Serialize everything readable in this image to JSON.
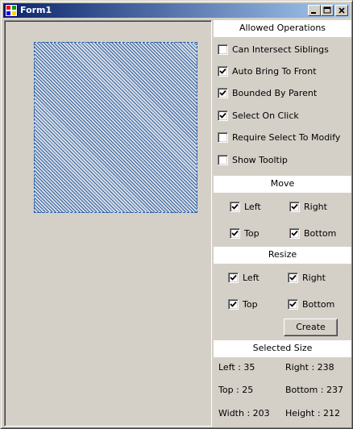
{
  "window": {
    "title": "Form1"
  },
  "caption_buttons": {
    "minimize": "minimize-icon",
    "maximize": "maximize-icon",
    "close": "close-icon"
  },
  "canvas": {
    "shape_fill": "#2e5f9e",
    "shape_border": "#2b5ea7"
  },
  "allowed_operations": {
    "header": "Allowed Operations",
    "options": [
      {
        "label": "Can Intersect Siblings",
        "checked": false
      },
      {
        "label": "Auto Bring To Front",
        "checked": true
      },
      {
        "label": "Bounded By Parent",
        "checked": true
      },
      {
        "label": "Select On Click",
        "checked": true
      },
      {
        "label": "Require Select To Modify",
        "checked": false
      },
      {
        "label": "Show Tooltip",
        "checked": false
      }
    ]
  },
  "move": {
    "header": "Move",
    "left": {
      "label": "Left",
      "checked": true
    },
    "right": {
      "label": "Right",
      "checked": true
    },
    "top": {
      "label": "Top",
      "checked": true
    },
    "bottom": {
      "label": "Bottom",
      "checked": true
    }
  },
  "resize": {
    "header": "Resize",
    "left": {
      "label": "Left",
      "checked": true
    },
    "right": {
      "label": "Right",
      "checked": true
    },
    "top": {
      "label": "Top",
      "checked": true
    },
    "bottom": {
      "label": "Bottom",
      "checked": true
    }
  },
  "create_button": {
    "label": "Create"
  },
  "selected_size": {
    "header": "Selected Size",
    "left": "Left : 35",
    "right": "Right : 238",
    "top": "Top : 25",
    "bottom": "Bottom : 237",
    "width": "Width : 203",
    "height": "Height : 212"
  }
}
